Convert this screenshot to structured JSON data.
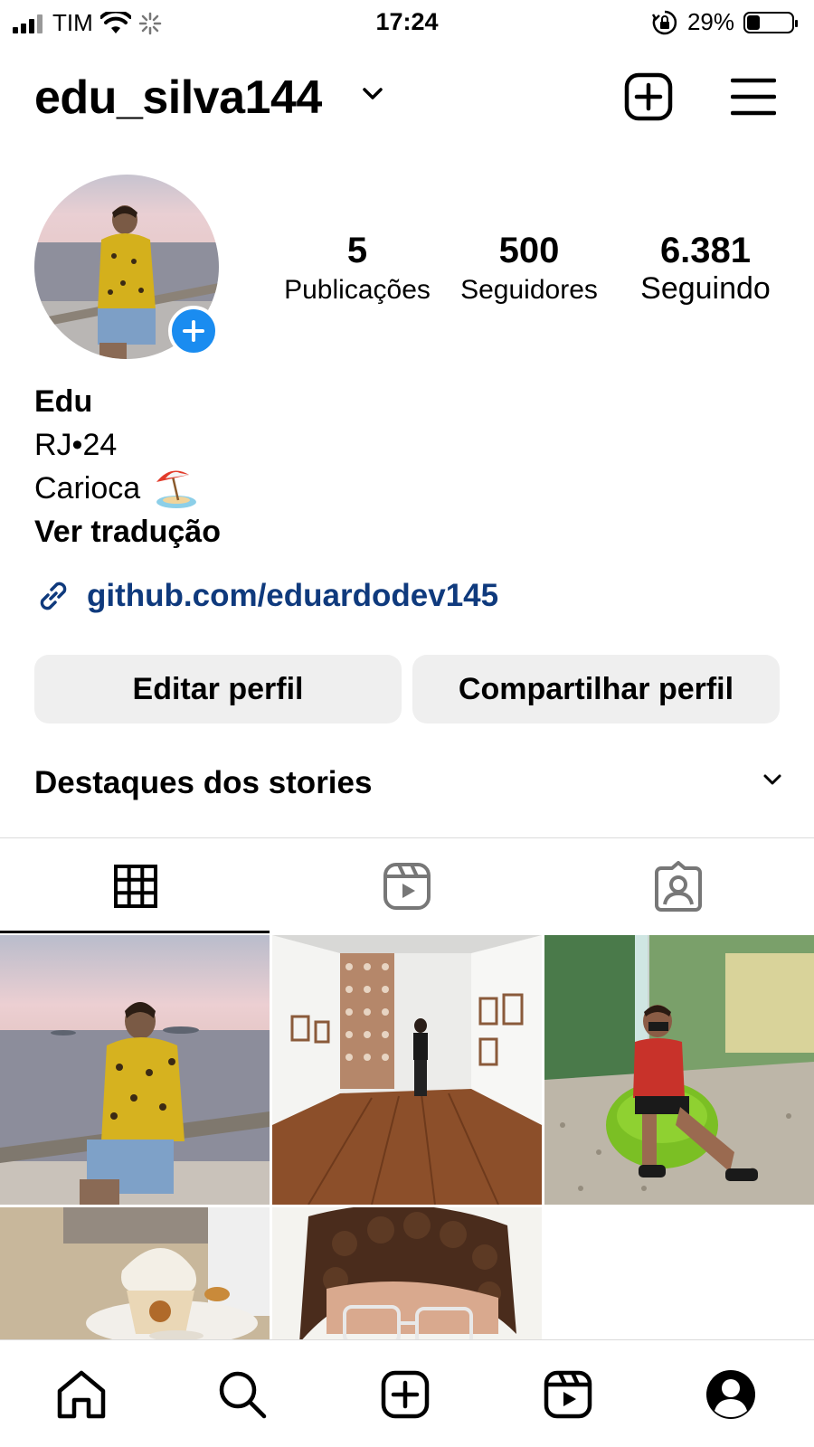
{
  "status_bar": {
    "carrier": "TIM",
    "time": "17:24",
    "battery_percent": "29%",
    "battery_level": 0.29
  },
  "header": {
    "username": "edu_silva144",
    "chevron_icon": "chevron-down-icon",
    "new_post_icon": "plus-square-icon",
    "menu_icon": "hamburger-menu-icon"
  },
  "profile": {
    "stats": [
      {
        "value": "5",
        "label": "Publicações"
      },
      {
        "value": "500",
        "label": "Seguidores"
      },
      {
        "value": "6.381",
        "label": "Seguindo"
      }
    ],
    "name": "Edu",
    "bio_line_1": "RJ•24",
    "bio_line_2": "Carioca",
    "bio_emoji": "beach-umbrella-emoji",
    "translate_label": "Ver tradução",
    "link": "github.com/eduardodev145",
    "link_icon": "link-icon"
  },
  "buttons": {
    "edit": "Editar perfil",
    "share": "Compartilhar perfil"
  },
  "highlights": {
    "title": "Destaques dos stories"
  },
  "tabs": [
    {
      "icon": "grid-icon",
      "active": true
    },
    {
      "icon": "reels-icon",
      "active": false
    },
    {
      "icon": "tagged-icon",
      "active": false
    }
  ],
  "posts": [
    {
      "description": "sea-view-photo"
    },
    {
      "description": "gallery-photo"
    },
    {
      "description": "green-chair-photo"
    },
    {
      "description": "coffee-photo"
    },
    {
      "description": "selfie-photo"
    }
  ],
  "bottom_nav": [
    {
      "icon": "home-icon"
    },
    {
      "icon": "search-icon"
    },
    {
      "icon": "create-icon"
    },
    {
      "icon": "reels-icon"
    },
    {
      "icon": "profile-icon"
    }
  ],
  "colors": {
    "link": "#0f3a7d",
    "accent_blue": "#1a8cf0",
    "button_bg": "#efefef",
    "divider": "#dbdbdb"
  }
}
